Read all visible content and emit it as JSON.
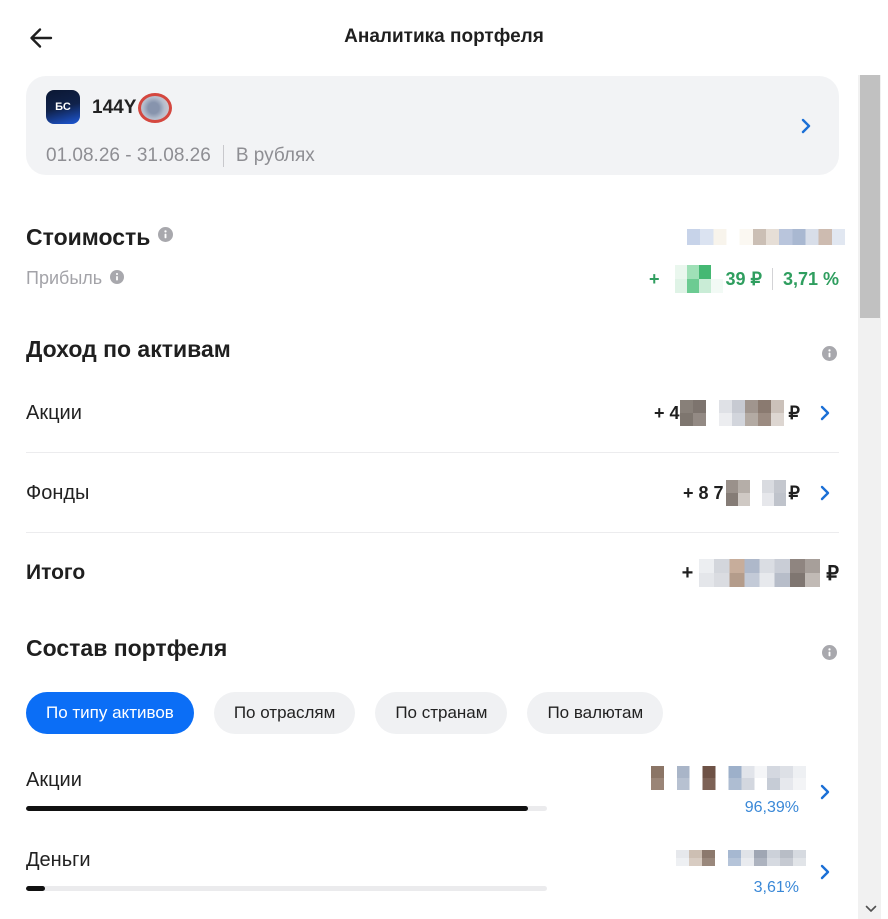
{
  "colors": {
    "accent": "#0b6ef6",
    "chevron": "#1b6fd6",
    "profit": "#2f9e5f",
    "percent": "#3a88d7",
    "redaction": "#d4473f"
  },
  "header": {
    "title": "Аналитика портфеля",
    "back_icon": "arrow-left-icon"
  },
  "account": {
    "logo_text": "БС",
    "name": "144Y",
    "period": "01.08.26 - 31.08.26",
    "currency": "В рублях",
    "chevron_icon": "chevron-right-icon"
  },
  "summary": {
    "value_label": "Стоимость",
    "profit_label": "Прибыль",
    "profit_prefix": "+",
    "profit_amount_suffix": "39 ₽",
    "profit_percent": "3,71 %",
    "info_icon": "info-icon"
  },
  "income": {
    "heading": "Доход по активам",
    "rows": [
      {
        "label": "Акции",
        "prefix": "+ 4",
        "suffix": "₽"
      },
      {
        "label": "Фонды",
        "prefix": "+ 8 7",
        "suffix": "₽"
      }
    ],
    "total": {
      "label": "Итого",
      "prefix": "+",
      "suffix": "₽"
    }
  },
  "composition": {
    "heading": "Состав портфеля",
    "chips": [
      {
        "label": "По типу активов",
        "selected": true
      },
      {
        "label": "По отраслям",
        "selected": false
      },
      {
        "label": "По странам",
        "selected": false
      },
      {
        "label": "По валютам",
        "selected": false
      }
    ],
    "breakdown": [
      {
        "label": "Акции",
        "percent": "96,39%",
        "share": 0.9639
      },
      {
        "label": "Деньги",
        "percent": "3,61%",
        "share": 0.0361
      }
    ]
  }
}
